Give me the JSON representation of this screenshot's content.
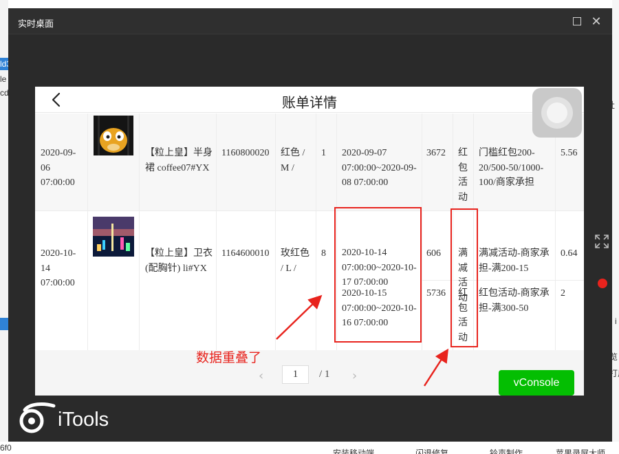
{
  "window": {
    "title": "实时桌面",
    "maximize_icon": "maximize-icon",
    "close_icon": "close-icon"
  },
  "page": {
    "title": "账单详情",
    "back_icon": "chevron-left-icon"
  },
  "rows": [
    {
      "date": "2020-09-06 07:00:00",
      "product": "【粒上皇】半身裙 coffee07#YX",
      "id": "1160800020",
      "spec": "红色 / M /",
      "qty": "1",
      "period": "2020-09-07 07:00:00~2020-09-08 07:00:00",
      "activity_id": "3672",
      "activity_type": "红包活动",
      "rule": "门槛红包200-20/500-50/1000-100/商家承担",
      "amount": "5.56"
    },
    {
      "date": "2020-10-14 07:00:00",
      "product": "【粒上皇】卫衣(配胸针) li#YX",
      "id": "1164600010",
      "spec": "玫红色 / L /",
      "qty": "8",
      "sub": [
        {
          "period": "2020-10-14 07:00:00~2020-10-17 07:00:00",
          "activity_id": "606",
          "activity_type": "满减活动",
          "rule": "满减活动-商家承担-满200-15",
          "amount": "0.64"
        },
        {
          "period": "2020-10-15 07:00:00~2020-10-16 07:00:00",
          "activity_id": "5736",
          "activity_type": "红包活动",
          "rule": "红包活动-商家承担-满300-50",
          "amount": "2"
        }
      ]
    }
  ],
  "pagination": {
    "current": "1",
    "total": "/ 1",
    "prev_icon": "chevron-left-icon",
    "next_icon": "chevron-right-icon"
  },
  "vconsole_label": "vConsole",
  "annotation": "数据重叠了",
  "brand": "iTools",
  "background_fragments": [
    "ld3",
    "le",
    "cd",
    "社",
    "i",
    "览",
    "打用",
    "6f0",
    "安装移动端",
    "闪退修复",
    "铃声制作",
    "苹果录屏大师"
  ],
  "colors": {
    "annotation_red": "#e8231d",
    "vconsole_green": "#04be02",
    "window_dark": "#2a2a2a"
  }
}
